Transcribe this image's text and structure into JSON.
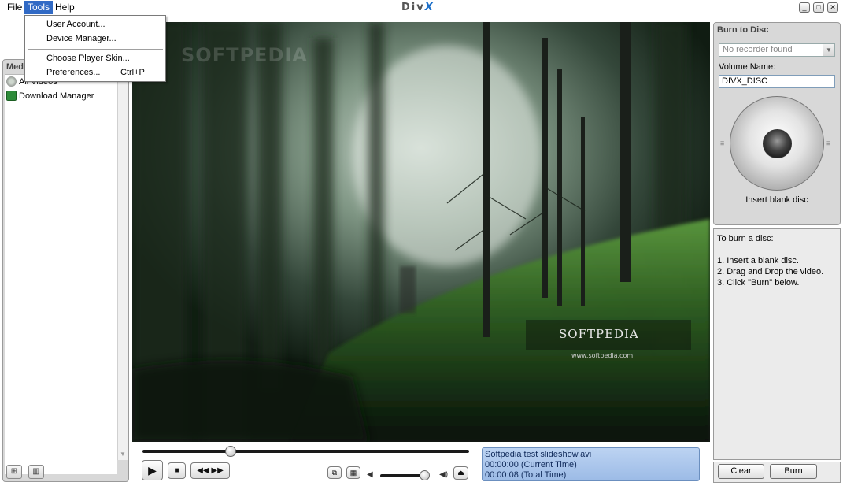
{
  "menubar": {
    "items": [
      "File",
      "Tools",
      "Help"
    ],
    "logo": "DivX",
    "window_buttons": [
      "minimize-icon",
      "restore-icon",
      "close-icon"
    ]
  },
  "tools_menu": {
    "items": [
      {
        "label": "User Account...",
        "shortcut": ""
      },
      {
        "label": "Device Manager...",
        "shortcut": ""
      },
      {
        "label": "Choose Player Skin...",
        "shortcut": ""
      },
      {
        "label": "Preferences...",
        "shortcut": "Ctrl+P"
      }
    ]
  },
  "media_panel": {
    "header": "Media",
    "items": [
      {
        "label": "All Videos",
        "icon": "film-reel-icon"
      },
      {
        "label": "Download Manager",
        "icon": "download-icon"
      }
    ],
    "footer_buttons": [
      "add-folder-icon",
      "delete-icon"
    ]
  },
  "video": {
    "watermark_top": "SOFTPEDIA",
    "watermark_main": "SOFTPEDIA",
    "watermark_url": "www.softpedia.com"
  },
  "playback": {
    "seek_fraction": 0.27,
    "volume_fraction": 0.95,
    "file_name": "Softpedia test slideshow.avi",
    "current_time_line": "00:00:00  (Current Time)",
    "total_time_line": "00:00:08  (Total Time)"
  },
  "burn": {
    "title": "Burn to Disc",
    "recorder_value": "No recorder found",
    "volume_label": "Volume Name:",
    "volume_value": "DIVX_DISC",
    "disc_caption": "Insert blank disc",
    "instructions_title": "To burn a disc:",
    "steps": [
      "1. Insert a blank disc.",
      "2. Drag and Drop the video.",
      "3. Click \"Burn\" below."
    ],
    "clear_label": "Clear",
    "burn_label": "Burn"
  },
  "colors": {
    "menu_highlight": "#316ac5",
    "info_box": "#b4cdee",
    "panel_bg": "#d8d8d8"
  }
}
